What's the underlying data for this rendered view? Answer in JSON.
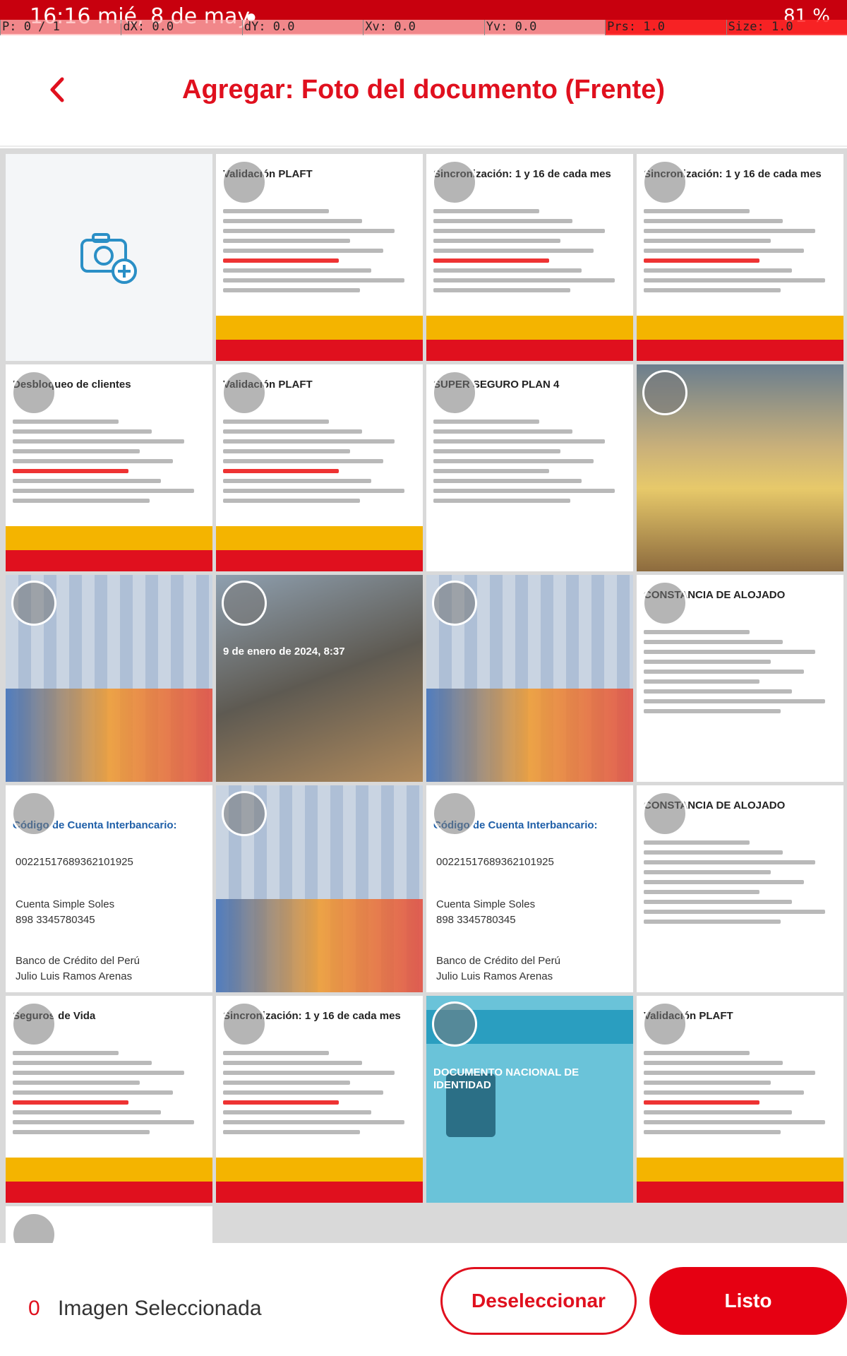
{
  "status_bar": {
    "time": "16:16",
    "date": "mié, 8 de may",
    "battery": "81 %"
  },
  "pointer_bar": {
    "p": "P: 0 / 1",
    "dx": "dX: 0.0",
    "dy": "dY: 0.0",
    "xv": "Xv: 0.0",
    "yv": "Yv: 0.0",
    "prs": "Prs: 1.0",
    "size": "Size: 1.0"
  },
  "header": {
    "title": "Agregar: Foto del documento (Frente)",
    "back_icon": "chevron-left-icon"
  },
  "tiles": [
    {
      "kind": "camera",
      "icon": "camera-add-icon"
    },
    {
      "kind": "doc",
      "caption": "Validación PLAFT"
    },
    {
      "kind": "doc",
      "caption": "Sincronización: 1 y 16 de cada mes"
    },
    {
      "kind": "doc",
      "caption": "Sincronización: 1 y 16 de cada mes"
    },
    {
      "kind": "doc",
      "caption": "Desbloqueo de clientes"
    },
    {
      "kind": "doc",
      "caption": "Validación PLAFT"
    },
    {
      "kind": "form",
      "caption": "SUPER SEGURO PLAN 4"
    },
    {
      "kind": "photo-house",
      "caption": ""
    },
    {
      "kind": "photo-bills",
      "caption": ""
    },
    {
      "kind": "photo-street",
      "caption": "9 de enero de 2024, 8:37"
    },
    {
      "kind": "photo-bills",
      "caption": ""
    },
    {
      "kind": "letter",
      "caption": "CONSTANCIA DE ALOJADO"
    },
    {
      "kind": "bank",
      "caption": "Código de Cuenta Interbancario:",
      "line1": "00221517689362101925",
      "line2": "Cuenta Simple Soles",
      "line3": "898 3345780345",
      "line4": "Banco de Crédito del Perú",
      "line5": "Julio Luis Ramos Arenas"
    },
    {
      "kind": "photo-bills",
      "caption": ""
    },
    {
      "kind": "bank",
      "caption": "Código de Cuenta Interbancario:",
      "line1": "00221517689362101925",
      "line2": "Cuenta Simple Soles",
      "line3": "898 3345780345",
      "line4": "Banco de Crédito del Perú",
      "line5": "Julio Luis Ramos Arenas"
    },
    {
      "kind": "letter",
      "caption": "CONSTANCIA DE ALOJADO"
    },
    {
      "kind": "doc",
      "caption": "Seguros de Vida"
    },
    {
      "kind": "doc",
      "caption": "Sincronización: 1 y 16 de cada mes"
    },
    {
      "kind": "photo-id",
      "caption": "DOCUMENTO NACIONAL DE IDENTIDAD"
    },
    {
      "kind": "doc",
      "caption": "Validación PLAFT"
    },
    {
      "kind": "doc-partial",
      "caption": ""
    }
  ],
  "bottom_bar": {
    "selected_count": "0",
    "selected_label": "Imagen Seleccionada",
    "deselect_label": "Deseleccionar",
    "done_label": "Listo"
  },
  "colors": {
    "accent": "#e0101e",
    "status_bar": "#c8000e"
  }
}
